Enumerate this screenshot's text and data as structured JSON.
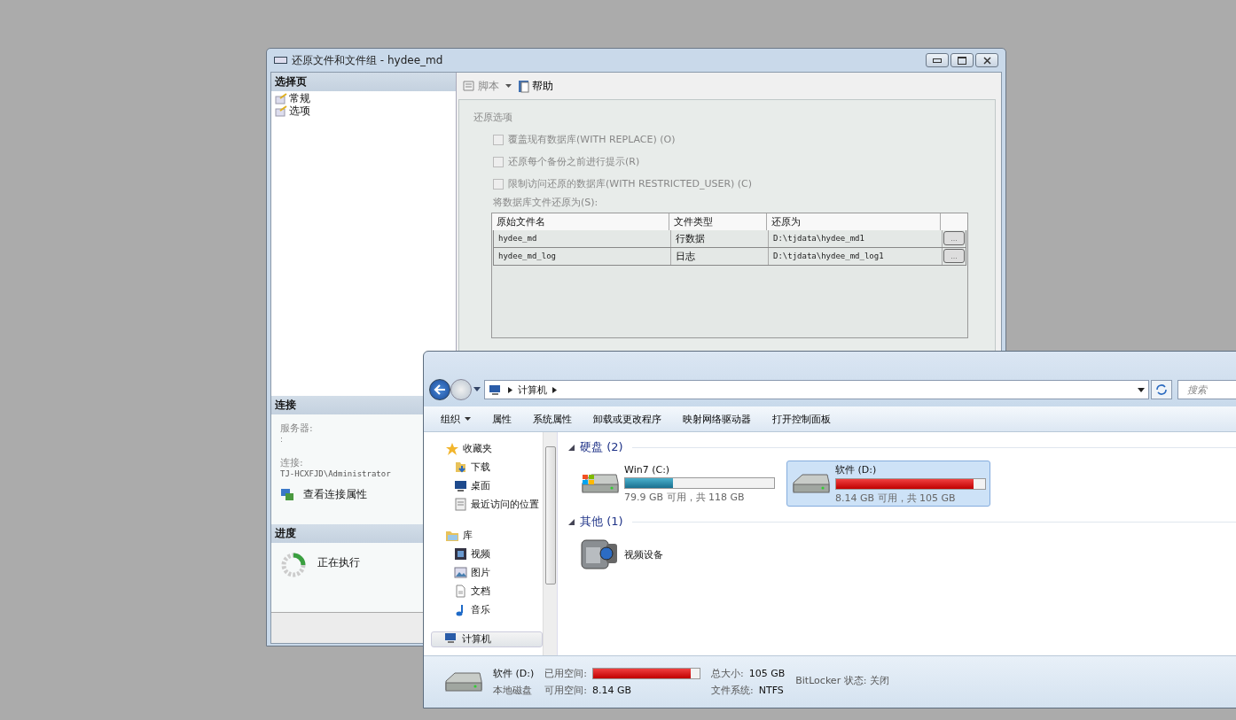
{
  "dialog": {
    "title": "还原文件和文件组 - hydee_md",
    "select_page": {
      "header": "选择页",
      "items": [
        {
          "label": "常规"
        },
        {
          "label": "选项"
        }
      ]
    },
    "connection": {
      "header": "连接",
      "server_label": "服务器:",
      "server_value": ":",
      "connection_label": "连接:",
      "connection_value": "TJ-HCXFJD\\Administrator",
      "link": "查看连接属性"
    },
    "progress": {
      "header": "进度",
      "status": "正在执行"
    },
    "toolbar": {
      "script": "脚本",
      "help": "帮助"
    },
    "options": {
      "section": "还原选项",
      "checkboxes": [
        {
          "label": "覆盖现有数据库(WITH REPLACE) (O)",
          "checked": false,
          "disabled": true
        },
        {
          "label": "还原每个备份之前进行提示(R)",
          "checked": false,
          "disabled": true
        },
        {
          "label": "限制访问还原的数据库(WITH RESTRICTED_USER) (C)",
          "checked": false,
          "disabled": true
        }
      ],
      "restore_as_label": "将数据库文件还原为(S):"
    },
    "table": {
      "columns": [
        "原始文件名",
        "文件类型",
        "还原为"
      ],
      "rows": [
        {
          "cells": [
            "hydee_md",
            "行数据",
            "D:\\tjdata\\hydee_md1"
          ],
          "button": "..."
        },
        {
          "cells": [
            "hydee_md_log",
            "日志",
            "D:\\tjdata\\hydee_md_log1"
          ],
          "button": "..."
        }
      ]
    }
  },
  "explorer": {
    "address": "计算机",
    "search": {
      "placeholder": "搜索"
    },
    "toolbar": [
      {
        "label": "组织",
        "dropdown": true
      },
      {
        "label": "属性",
        "dropdown": false
      },
      {
        "label": "系统属性",
        "dropdown": false
      },
      {
        "label": "卸载或更改程序",
        "dropdown": false
      },
      {
        "label": "映射网络驱动器",
        "dropdown": false
      },
      {
        "label": "打开控制面板",
        "dropdown": false
      }
    ],
    "nav": [
      {
        "label": "收藏夹",
        "kind": "star",
        "selected": false,
        "children": [
          {
            "label": "下载",
            "kind": "download",
            "selected": false
          },
          {
            "label": "桌面",
            "kind": "desktop",
            "selected": false
          },
          {
            "label": "最近访问的位置",
            "kind": "recent",
            "selected": false
          }
        ]
      },
      {
        "label": "库",
        "kind": "library",
        "selected": false,
        "children": [
          {
            "label": "视频",
            "kind": "video",
            "selected": false
          },
          {
            "label": "图片",
            "kind": "picture",
            "selected": false
          },
          {
            "label": "文档",
            "kind": "document",
            "selected": false
          },
          {
            "label": "音乐",
            "kind": "music",
            "selected": false
          }
        ]
      },
      {
        "label": "计算机",
        "kind": "computer",
        "selected": true
      }
    ],
    "groups": [
      {
        "title": "硬盘 (2)",
        "items": [
          {
            "kind": "drive",
            "name": "Win7 (C:)",
            "level": 0.32,
            "info": "79.9 GB 可用，共 118 GB",
            "selected": false,
            "system": true
          },
          {
            "kind": "drive",
            "name": "软件 (D:)",
            "level": 0.92,
            "info": "8.14 GB 可用，共 105 GB",
            "selected": true,
            "system": false
          }
        ]
      },
      {
        "title": "其他 (1)",
        "items": [
          {
            "kind": "camera",
            "name": "视频设备",
            "selected": false
          }
        ]
      }
    ],
    "status": {
      "name": "软件 (D:)",
      "type": "本地磁盘",
      "used_label": "已用空间:",
      "level": 0.92,
      "free_label": "可用空间:",
      "free_value": "8.14 GB",
      "total_label": "总大小:",
      "total_value": "105 GB",
      "fs_label": "文件系统:",
      "fs_value": "NTFS",
      "bitlocker": "BitLocker 状态: 关闭"
    }
  }
}
